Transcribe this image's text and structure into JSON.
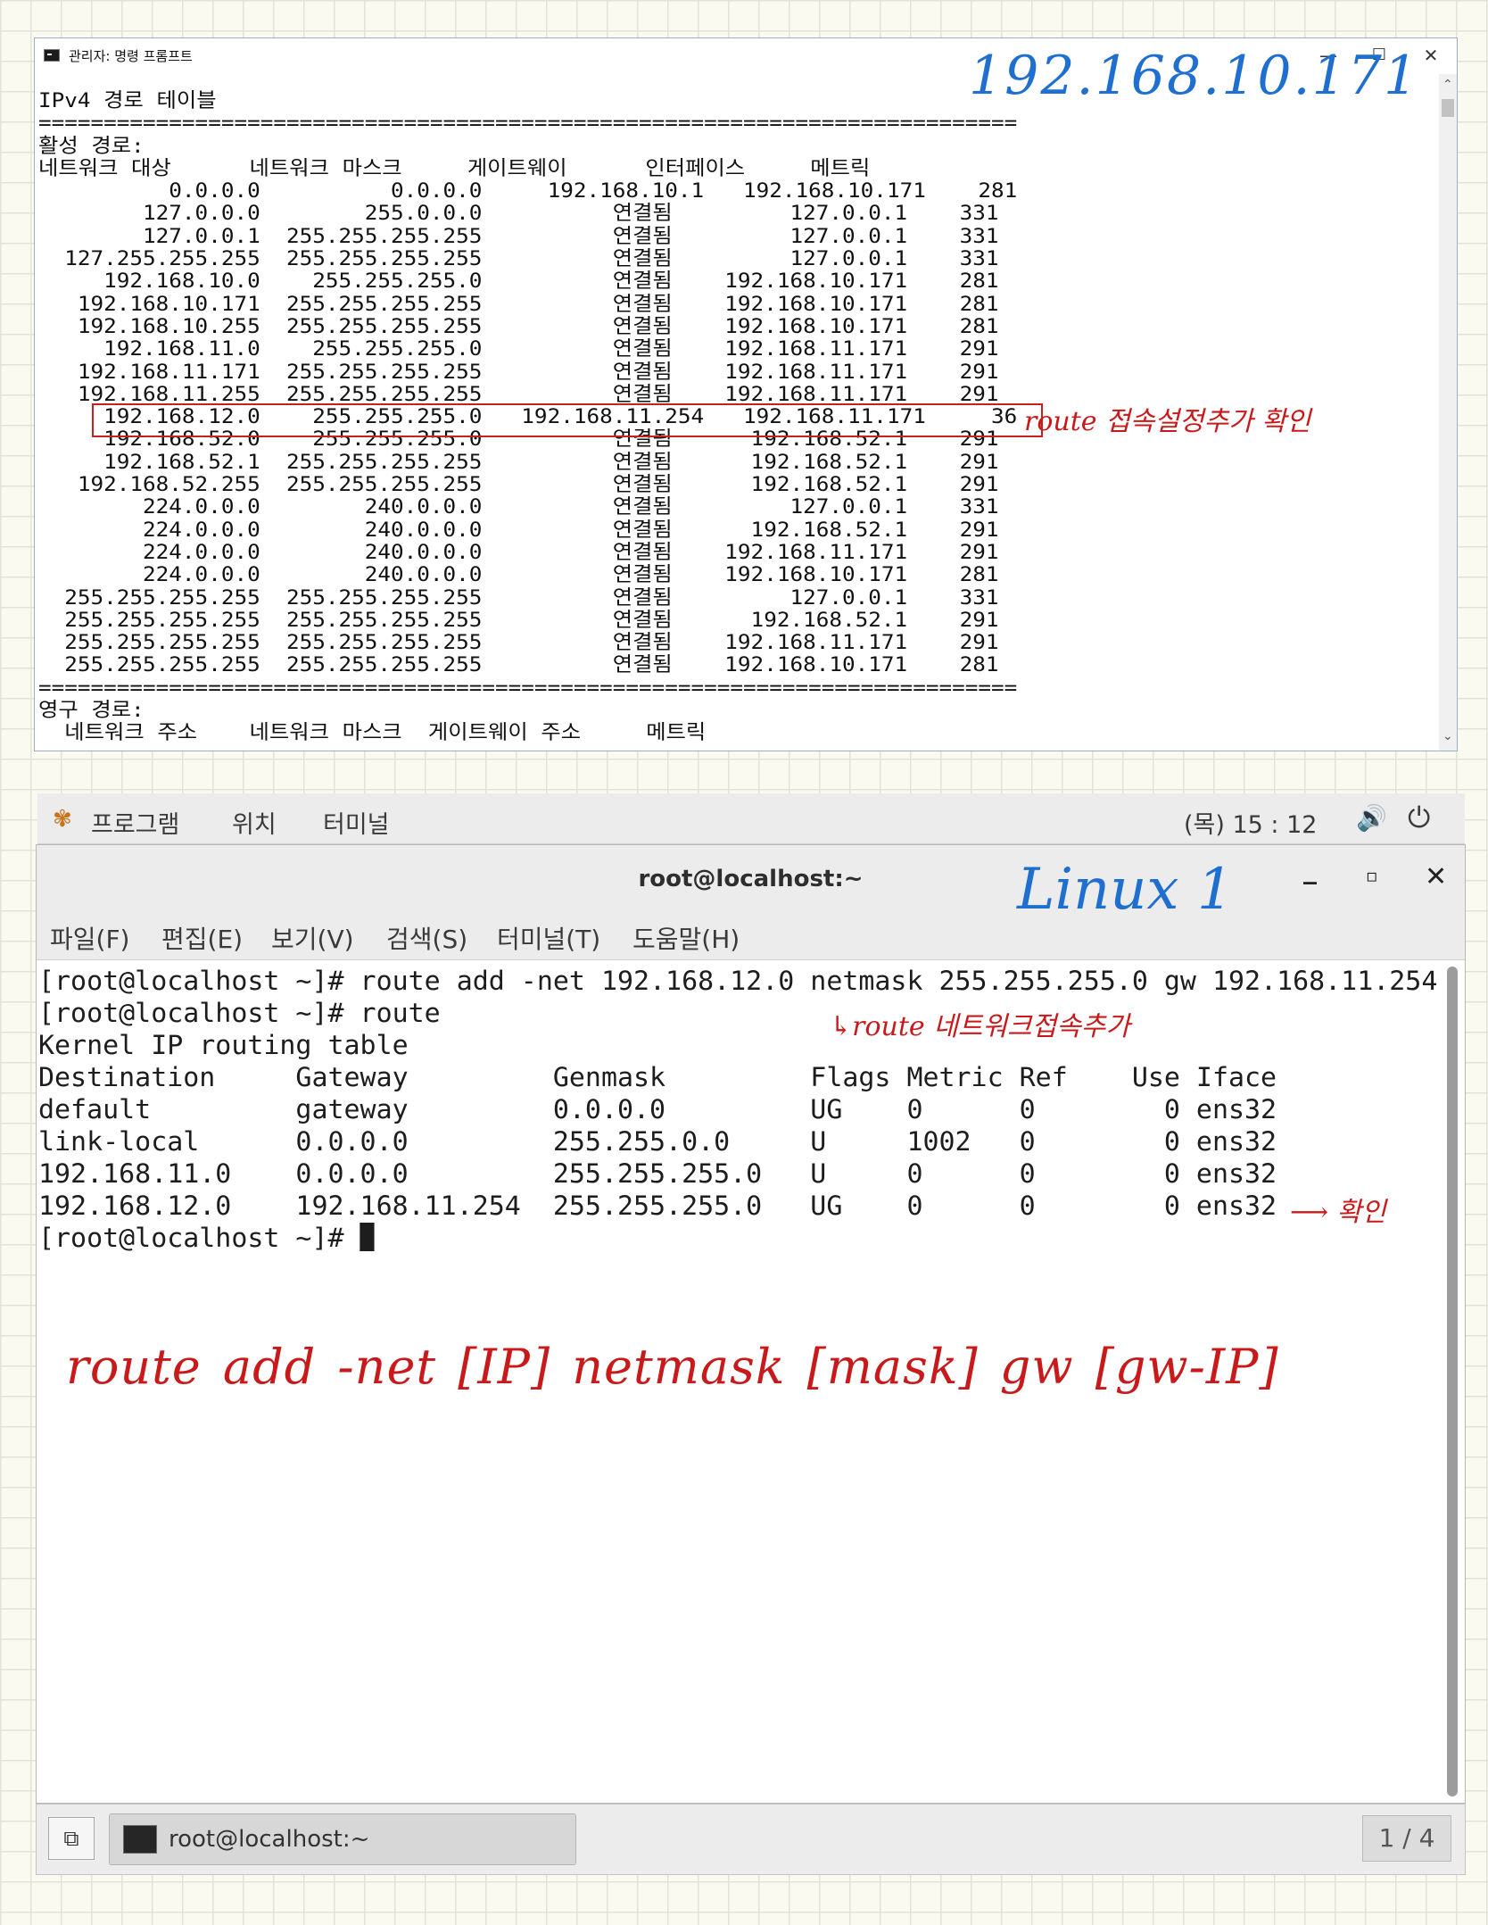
{
  "cmd": {
    "title": "관리자: 명령 프롬프트",
    "min_icon": "—",
    "max_icon": "☐",
    "close_icon": "✕",
    "scroll_up": "⌃",
    "scroll_down": "⌄",
    "content": "IPv4 경로 테이블\n===========================================================================\n활성 경로:\n네트워크 대상      네트워크 마스크     게이트웨이      인터페이스     메트릭\n          0.0.0.0          0.0.0.0     192.168.10.1   192.168.10.171    281\n        127.0.0.0        255.0.0.0          연결됨         127.0.0.1    331\n        127.0.0.1  255.255.255.255          연결됨         127.0.0.1    331\n  127.255.255.255  255.255.255.255          연결됨         127.0.0.1    331\n     192.168.10.0    255.255.255.0          연결됨    192.168.10.171    281\n   192.168.10.171  255.255.255.255          연결됨    192.168.10.171    281\n   192.168.10.255  255.255.255.255          연결됨    192.168.10.171    281\n     192.168.11.0    255.255.255.0          연결됨    192.168.11.171    291\n   192.168.11.171  255.255.255.255          연결됨    192.168.11.171    291\n   192.168.11.255  255.255.255.255          연결됨    192.168.11.171    291\n     192.168.12.0    255.255.255.0   192.168.11.254   192.168.11.171     36\n     192.168.52.0    255.255.255.0          연결됨      192.168.52.1    291\n     192.168.52.1  255.255.255.255          연결됨      192.168.52.1    291\n   192.168.52.255  255.255.255.255          연결됨      192.168.52.1    291\n        224.0.0.0        240.0.0.0          연결됨         127.0.0.1    331\n        224.0.0.0        240.0.0.0          연결됨      192.168.52.1    291\n        224.0.0.0        240.0.0.0          연결됨    192.168.11.171    291\n        224.0.0.0        240.0.0.0          연결됨    192.168.10.171    281\n  255.255.255.255  255.255.255.255          연결됨         127.0.0.1    331\n  255.255.255.255  255.255.255.255          연결됨      192.168.52.1    291\n  255.255.255.255  255.255.255.255          연결됨    192.168.11.171    291\n  255.255.255.255  255.255.255.255          연결됨    192.168.10.171    281\n===========================================================================\n영구 경로:\n  네트워크 주소    네트워크 마스크  게이트웨이 주소     메트릭"
  },
  "panel": {
    "apps_icon": "✾",
    "programs": "프로그램",
    "places": "위치",
    "terminal": "터미널",
    "clock": "(목) 15 : 12",
    "volume_icon": "🔊",
    "power_icon": "⏻"
  },
  "terminal": {
    "title": "root@localhost:~",
    "min_icon": "_",
    "max_icon": "▫",
    "close_icon": "✕",
    "menu": {
      "file": "파일(F)",
      "edit": "편집(E)",
      "view": "보기(V)",
      "search": "검색(S)",
      "terminal": "터미널(T)",
      "help": "도움말(H)"
    },
    "content": "[root@localhost ~]# route add -net 192.168.12.0 netmask 255.255.255.0 gw 192.168.11.254\n[root@localhost ~]# route\nKernel IP routing table\nDestination     Gateway         Genmask         Flags Metric Ref    Use Iface\ndefault         gateway         0.0.0.0         UG    0      0        0 ens32\nlink-local      0.0.0.0         255.255.0.0     U     1002   0        0 ens32\n192.168.11.0    0.0.0.0         255.255.255.0   U     0      0        0 ens32\n192.168.12.0    192.168.11.254  255.255.255.0   UG    0      0        0 ens32\n",
    "prompt": "[root@localhost ~]# "
  },
  "taskbar": {
    "show_desktop_icon": "⧉",
    "task_label": "root@localhost:~",
    "workspace": "1 / 4"
  },
  "notes": {
    "cmd_ip": "192.168.10.171",
    "route_added": "route 접속설정추가 확인",
    "linux": "Linux 1",
    "route_cmd": "↳route 네트워크접속추가",
    "confirm": "⟶ 확인",
    "syntax": "route add -net [IP] netmask [mask] gw [gw-IP]"
  },
  "colors": {
    "annotation_red": "#c81a1a",
    "annotation_blue": "#1e6fd0"
  }
}
